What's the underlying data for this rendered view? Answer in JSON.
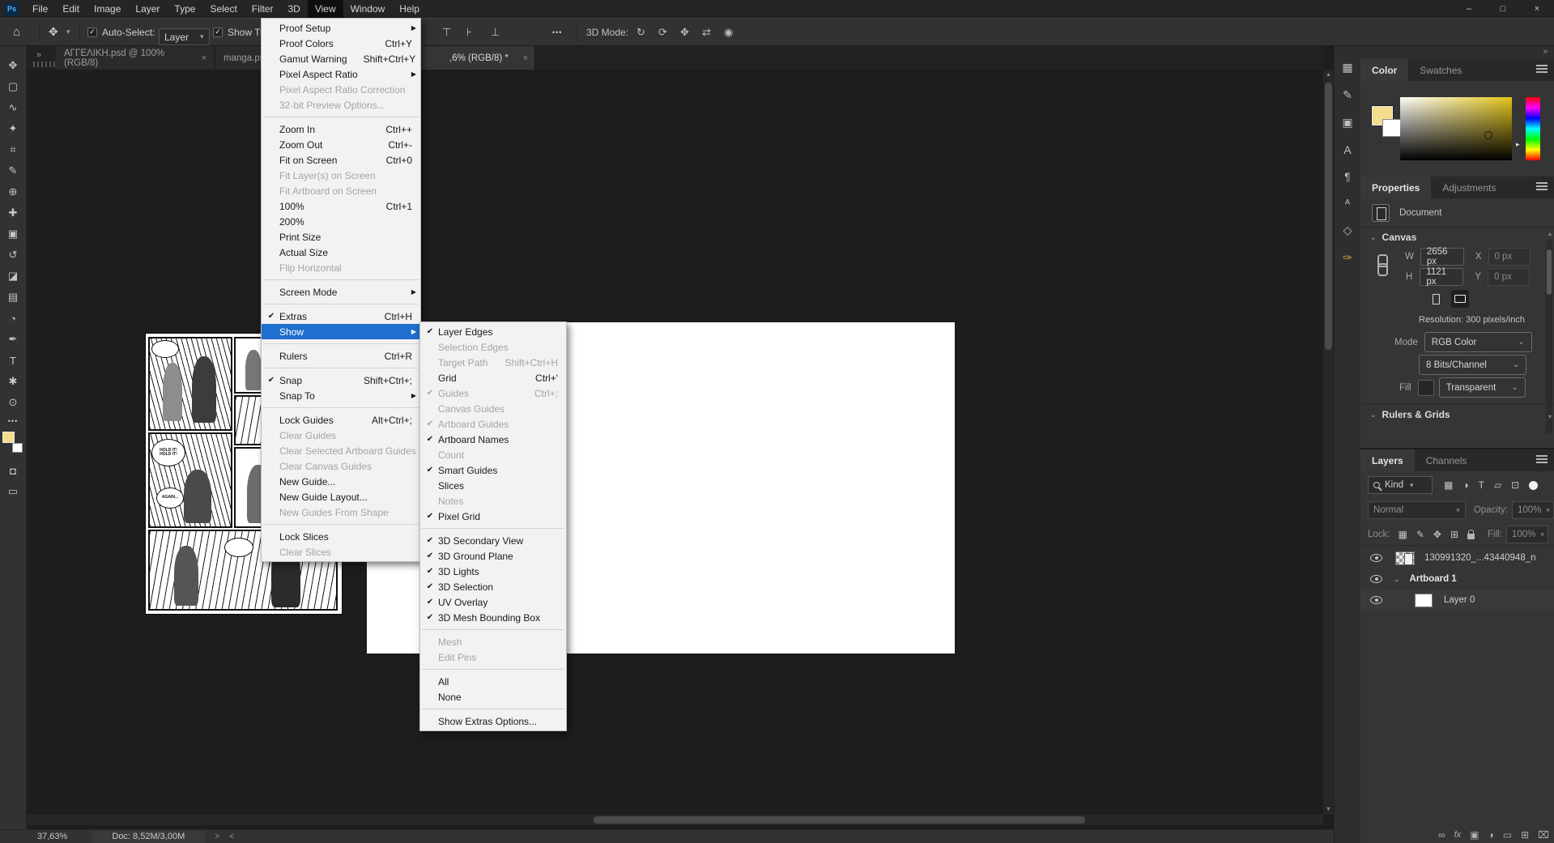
{
  "accent_colors": {
    "menu_highlight": "#1f6fce",
    "foreground_swatch": "#f6dd8d",
    "logo_blue": "#5cb3ff"
  },
  "menubar": {
    "logo": "Ps",
    "items": [
      {
        "label": "File"
      },
      {
        "label": "Edit"
      },
      {
        "label": "Image"
      },
      {
        "label": "Layer"
      },
      {
        "label": "Type"
      },
      {
        "label": "Select"
      },
      {
        "label": "Filter"
      },
      {
        "label": "3D"
      },
      {
        "label": "View",
        "active": true
      },
      {
        "label": "Window"
      },
      {
        "label": "Help"
      }
    ],
    "window_controls": {
      "minimize": "–",
      "maximize": "□",
      "close": "×"
    }
  },
  "options_bar": {
    "home_icon": "⌂",
    "move_tool_icon": "✥",
    "move_tool_chevron": "▾",
    "auto_select_checked": "✓",
    "auto_select_label": "Auto-Select:",
    "auto_select_value": "Layer",
    "auto_select_chevron": "▾",
    "show_transform_checked": "✓",
    "show_transform_label": "Show Transform Controls",
    "align_icons": [
      {
        "name": "align-top-edges-icon",
        "glyph": "⊤"
      },
      {
        "name": "align-vertical-centers-icon",
        "glyph": "⊦"
      },
      {
        "name": "align-bottom-edges-icon",
        "glyph": "⊥"
      }
    ],
    "more_options": "•••",
    "mode_label": "3D Mode:",
    "mode_icons": [
      {
        "name": "3d-orbit-icon",
        "glyph": "↻"
      },
      {
        "name": "3d-roll-icon",
        "glyph": "⟳"
      },
      {
        "name": "3d-drag-icon",
        "glyph": "✥"
      },
      {
        "name": "3d-slide-icon",
        "glyph": "⇄"
      },
      {
        "name": "3d-camera-icon",
        "glyph": "◉"
      }
    ]
  },
  "tab_bar": {
    "overflow_chevron": "»",
    "tabs": [
      {
        "label": "ΑΓΓΕΛΙΚΗ.psd @ 100% (RGB/8)",
        "close": "×",
        "active": false
      },
      {
        "label": "manga.psd @",
        "close": "",
        "active": false
      },
      {
        "label": ",6% (RGB/8) *",
        "close": "×",
        "active": true
      }
    ]
  },
  "left_toolbar": {
    "tools": [
      {
        "name": "move-tool",
        "glyph": "✥"
      },
      {
        "name": "rectangular-marquee-tool",
        "glyph": "▢"
      },
      {
        "name": "lasso-tool",
        "glyph": "∿"
      },
      {
        "name": "quick-selection-tool",
        "glyph": "✦"
      },
      {
        "name": "crop-tool",
        "glyph": "⌗"
      },
      {
        "name": "eyedropper-tool",
        "glyph": "✎"
      },
      {
        "name": "healing-brush-tool",
        "glyph": "⊕"
      },
      {
        "name": "brush-tool",
        "glyph": "✚"
      },
      {
        "name": "clone-stamp-tool",
        "glyph": "▣"
      },
      {
        "name": "history-brush-tool",
        "glyph": "↺"
      },
      {
        "name": "eraser-tool",
        "glyph": "◪"
      },
      {
        "name": "gradient-tool",
        "glyph": "▤"
      },
      {
        "name": "blur-tool",
        "glyph": "◔"
      },
      {
        "name": "pen-tool",
        "glyph": "✒"
      },
      {
        "name": "type-tool",
        "glyph": "T"
      },
      {
        "name": "hand-tool",
        "glyph": "✱"
      },
      {
        "name": "zoom-tool",
        "glyph": "⊙"
      }
    ],
    "more": "•••",
    "quick_mask_icon": "◘",
    "screen-mode_icon": "▭"
  },
  "view_menu": {
    "items": [
      {
        "label": "Proof Setup",
        "submenu": true
      },
      {
        "label": "Proof Colors",
        "shortcut": "Ctrl+Y"
      },
      {
        "label": "Gamut Warning",
        "shortcut": "Shift+Ctrl+Y"
      },
      {
        "label": "Pixel Aspect Ratio",
        "submenu": true
      },
      {
        "label": "Pixel Aspect Ratio Correction",
        "disabled": true
      },
      {
        "label": "32-bit Preview Options...",
        "disabled": true
      },
      {
        "type": "separator"
      },
      {
        "label": "Zoom In",
        "shortcut": "Ctrl++"
      },
      {
        "label": "Zoom Out",
        "shortcut": "Ctrl+-"
      },
      {
        "label": "Fit on Screen",
        "shortcut": "Ctrl+0"
      },
      {
        "label": "Fit Layer(s) on Screen",
        "disabled": true
      },
      {
        "label": "Fit Artboard on Screen",
        "disabled": true
      },
      {
        "label": "100%",
        "shortcut": "Ctrl+1"
      },
      {
        "label": "200%"
      },
      {
        "label": "Print Size"
      },
      {
        "label": "Actual Size"
      },
      {
        "label": "Flip Horizontal",
        "disabled": true
      },
      {
        "type": "separator"
      },
      {
        "label": "Screen Mode",
        "submenu": true
      },
      {
        "type": "separator"
      },
      {
        "label": "Extras",
        "checked": true,
        "shortcut": "Ctrl+H"
      },
      {
        "label": "Show",
        "submenu": true,
        "highlighted": true
      },
      {
        "type": "separator"
      },
      {
        "label": "Rulers",
        "shortcut": "Ctrl+R"
      },
      {
        "type": "separator"
      },
      {
        "label": "Snap",
        "checked": true,
        "shortcut": "Shift+Ctrl+;"
      },
      {
        "label": "Snap To",
        "submenu": true
      },
      {
        "type": "separator"
      },
      {
        "label": "Lock Guides",
        "shortcut": "Alt+Ctrl+;"
      },
      {
        "label": "Clear Guides",
        "disabled": true
      },
      {
        "label": "Clear Selected Artboard Guides",
        "disabled": true
      },
      {
        "label": "Clear Canvas Guides",
        "disabled": true
      },
      {
        "label": "New Guide..."
      },
      {
        "label": "New Guide Layout..."
      },
      {
        "label": "New Guides From Shape",
        "disabled": true
      },
      {
        "type": "separator"
      },
      {
        "label": "Lock Slices"
      },
      {
        "label": "Clear Slices",
        "disabled": true
      }
    ]
  },
  "show_submenu": {
    "items": [
      {
        "label": "Layer Edges",
        "checked": true
      },
      {
        "label": "Selection Edges",
        "disabled": true
      },
      {
        "label": "Target Path",
        "disabled": true,
        "shortcut": "Shift+Ctrl+H"
      },
      {
        "label": "Grid",
        "shortcut": "Ctrl+'"
      },
      {
        "label": "Guides",
        "checked": true,
        "disabled": true,
        "shortcut": "Ctrl+;"
      },
      {
        "label": "Canvas Guides",
        "disabled": true
      },
      {
        "label": "Artboard Guides",
        "checked": true,
        "disabled": true
      },
      {
        "label": "Artboard Names",
        "checked": true
      },
      {
        "label": "Count",
        "disabled": true
      },
      {
        "label": "Smart Guides",
        "checked": true
      },
      {
        "label": "Slices"
      },
      {
        "label": "Notes",
        "disabled": true
      },
      {
        "label": "Pixel Grid",
        "checked": true
      },
      {
        "type": "separator"
      },
      {
        "label": "3D Secondary View",
        "checked": true
      },
      {
        "label": "3D Ground Plane",
        "checked": true
      },
      {
        "label": "3D Lights",
        "checked": true
      },
      {
        "label": "3D Selection",
        "checked": true
      },
      {
        "label": "UV Overlay",
        "checked": true
      },
      {
        "label": "3D Mesh Bounding Box",
        "checked": true
      },
      {
        "type": "separator"
      },
      {
        "label": "Mesh",
        "disabled": true
      },
      {
        "label": "Edit Pins",
        "disabled": true
      },
      {
        "type": "separator"
      },
      {
        "label": "All"
      },
      {
        "label": "None"
      },
      {
        "type": "separator"
      },
      {
        "label": "Show Extras Options..."
      }
    ]
  },
  "right_strip": {
    "icons": [
      {
        "name": "libraries-panel-icon",
        "glyph": "▦"
      },
      {
        "name": "brush-settings-panel-icon",
        "glyph": "✎"
      },
      {
        "name": "clone-source-panel-icon",
        "glyph": "▣"
      },
      {
        "name": "character-panel-icon",
        "glyph": "A"
      },
      {
        "name": "paragraph-panel-icon",
        "glyph": "¶"
      },
      {
        "name": "glyphs-panel-icon",
        "glyph": "ᴬ"
      },
      {
        "name": "3d-panel-icon",
        "glyph": "◇"
      },
      {
        "name": "custom-panel-icon",
        "glyph": "✑",
        "color": "#c8a33f"
      }
    ],
    "collapse_chevron": "»"
  },
  "color_panel": {
    "tab_color": "Color",
    "tab_swatches": "Swatches",
    "foreground_color": "#f6dd8d",
    "hue_arrow": "▸"
  },
  "properties_panel": {
    "tab_properties": "Properties",
    "tab_adjustments": "Adjustments",
    "document_label": "Document",
    "canvas_section": "Canvas",
    "w_label": "W",
    "w_value": "2656 px",
    "x_label": "X",
    "x_value": "0 px",
    "h_label": "H",
    "h_value": "1121 px",
    "y_label": "Y",
    "y_value": "0 px",
    "resolution": "Resolution: 300 pixels/inch",
    "mode_label": "Mode",
    "mode_value": "RGB Color",
    "depth_value": "8 Bits/Channel",
    "fill_label": "Fill",
    "fill_value": "Transparent",
    "rulers_section": "Rulers & Grids",
    "chevron": "⌄",
    "scroll_up": "▴",
    "scroll_down": "▾"
  },
  "layers_panel": {
    "tab_layers": "Layers",
    "tab_channels": "Channels",
    "kind_label": "Kind",
    "kind_chevron": "▾",
    "filter_icons": [
      {
        "name": "filter-pixel-layers-icon",
        "glyph": "▦"
      },
      {
        "name": "filter-adjustment-layers-icon",
        "glyph": "◑"
      },
      {
        "name": "filter-type-layers-icon",
        "glyph": "T"
      },
      {
        "name": "filter-shape-layers-icon",
        "glyph": "▱"
      },
      {
        "name": "filter-smart-objects-icon",
        "glyph": "⊡"
      }
    ],
    "blend_mode": "Normal",
    "opacity_label": "Opacity:",
    "opacity_value": "100%",
    "lock_label": "Lock:",
    "lock_icons": [
      {
        "name": "lock-transparent-pixels-icon",
        "glyph": "▦"
      },
      {
        "name": "lock-image-pixels-icon",
        "glyph": "✎"
      },
      {
        "name": "lock-position-icon",
        "glyph": "✥"
      },
      {
        "name": "lock-artboard-icon",
        "glyph": "⊞"
      }
    ],
    "fill_label": "Fill:",
    "fill_value": "100%",
    "layers": [
      {
        "name": "130991320_...43440948_n",
        "type": "smart-object"
      },
      {
        "name": "Artboard 1",
        "type": "artboard",
        "twirl": "⌄"
      },
      {
        "name": "Layer 0",
        "type": "white-layer"
      }
    ],
    "footer_icons": [
      {
        "name": "link-layers-icon",
        "glyph": "∞"
      },
      {
        "name": "layer-effects-icon",
        "glyph": "fx"
      },
      {
        "name": "add-layer-mask-icon",
        "glyph": "▣"
      },
      {
        "name": "adjustment-layer-icon",
        "glyph": "◑"
      },
      {
        "name": "new-group-icon",
        "glyph": "▭"
      },
      {
        "name": "new-layer-icon",
        "glyph": "⊞"
      },
      {
        "name": "delete-layer-icon",
        "glyph": "⌧"
      }
    ]
  },
  "status_bar": {
    "zoom": "37,63%",
    "doc": "Doc: 8,52M/3,00M",
    "next_chevron": ">",
    "prev_chevron": "<"
  },
  "artwork": {
    "bubble1": "HOLD IT! HOLD IT!",
    "bubble2": "AGAIN..."
  }
}
